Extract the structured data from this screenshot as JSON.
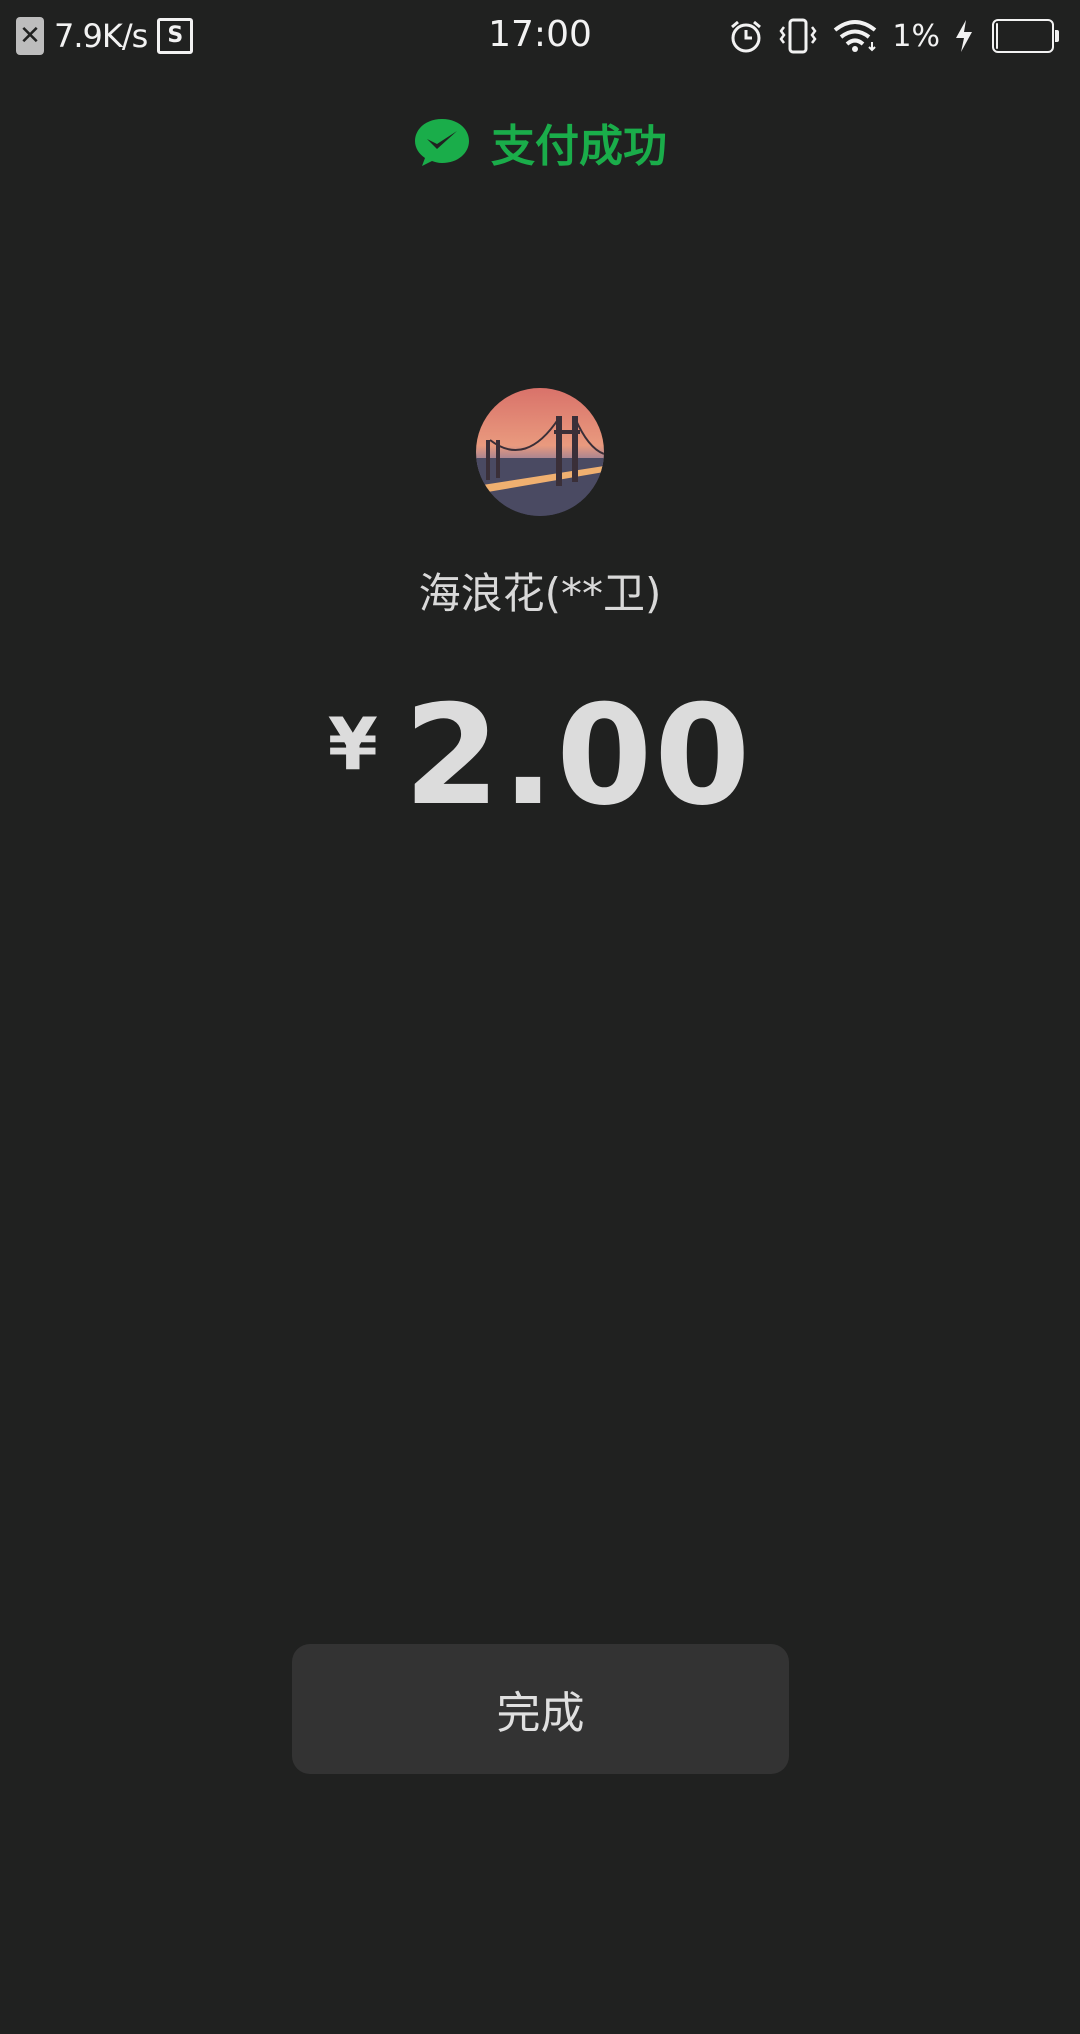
{
  "status_bar": {
    "close_glyph": "✕",
    "network_speed": "7.9K/s",
    "screenshot_glyph": "S",
    "time": "17:00",
    "battery_percent": "1%",
    "battery_level": 0.01,
    "icons": [
      "alarm-icon",
      "vibrate-icon",
      "wifi-icon",
      "charging-icon",
      "battery-icon"
    ]
  },
  "header": {
    "title": "支付成功",
    "icon": "wechat-pay-icon",
    "accent_color": "#1aad4a"
  },
  "payee": {
    "name": "海浪花(**卫)"
  },
  "payment": {
    "currency_symbol": "¥",
    "amount": "2.00"
  },
  "actions": {
    "done_label": "完成"
  },
  "colors": {
    "background": "#202120",
    "button_bg": "#333333",
    "accent": "#1aad4a"
  }
}
